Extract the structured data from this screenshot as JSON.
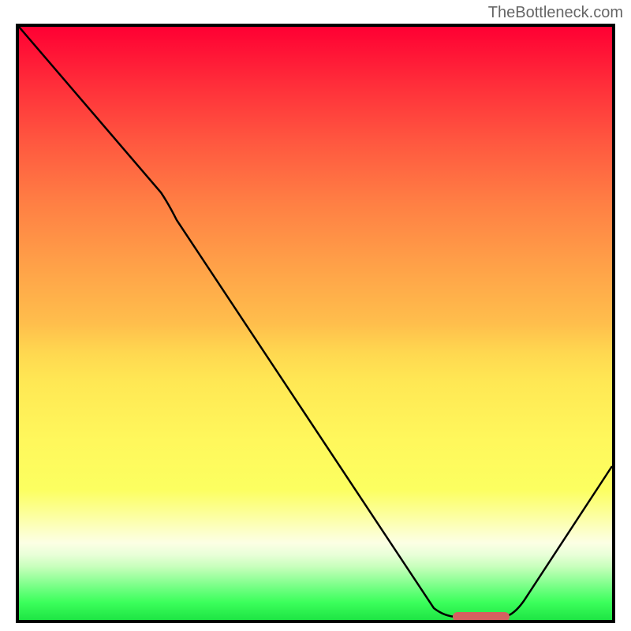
{
  "watermark": "TheBottleneck.com",
  "chart_data": {
    "type": "line",
    "title": "",
    "xlabel": "",
    "ylabel": "",
    "xlim": [
      0,
      100
    ],
    "ylim": [
      0,
      100
    ],
    "series": [
      {
        "name": "bottleneck-curve",
        "x": [
          0,
          24,
          70,
          74,
          82,
          100
        ],
        "y": [
          100,
          72,
          2,
          0.5,
          0.5,
          26
        ]
      }
    ],
    "marker": {
      "x_start": 74,
      "x_end": 82,
      "y": 0.5
    },
    "gradient_stops": [
      {
        "pos": 0,
        "color": "#ff0033"
      },
      {
        "pos": 50,
        "color": "#ffbe4c"
      },
      {
        "pos": 78,
        "color": "#fcff60"
      },
      {
        "pos": 100,
        "color": "#1ee544"
      }
    ]
  }
}
